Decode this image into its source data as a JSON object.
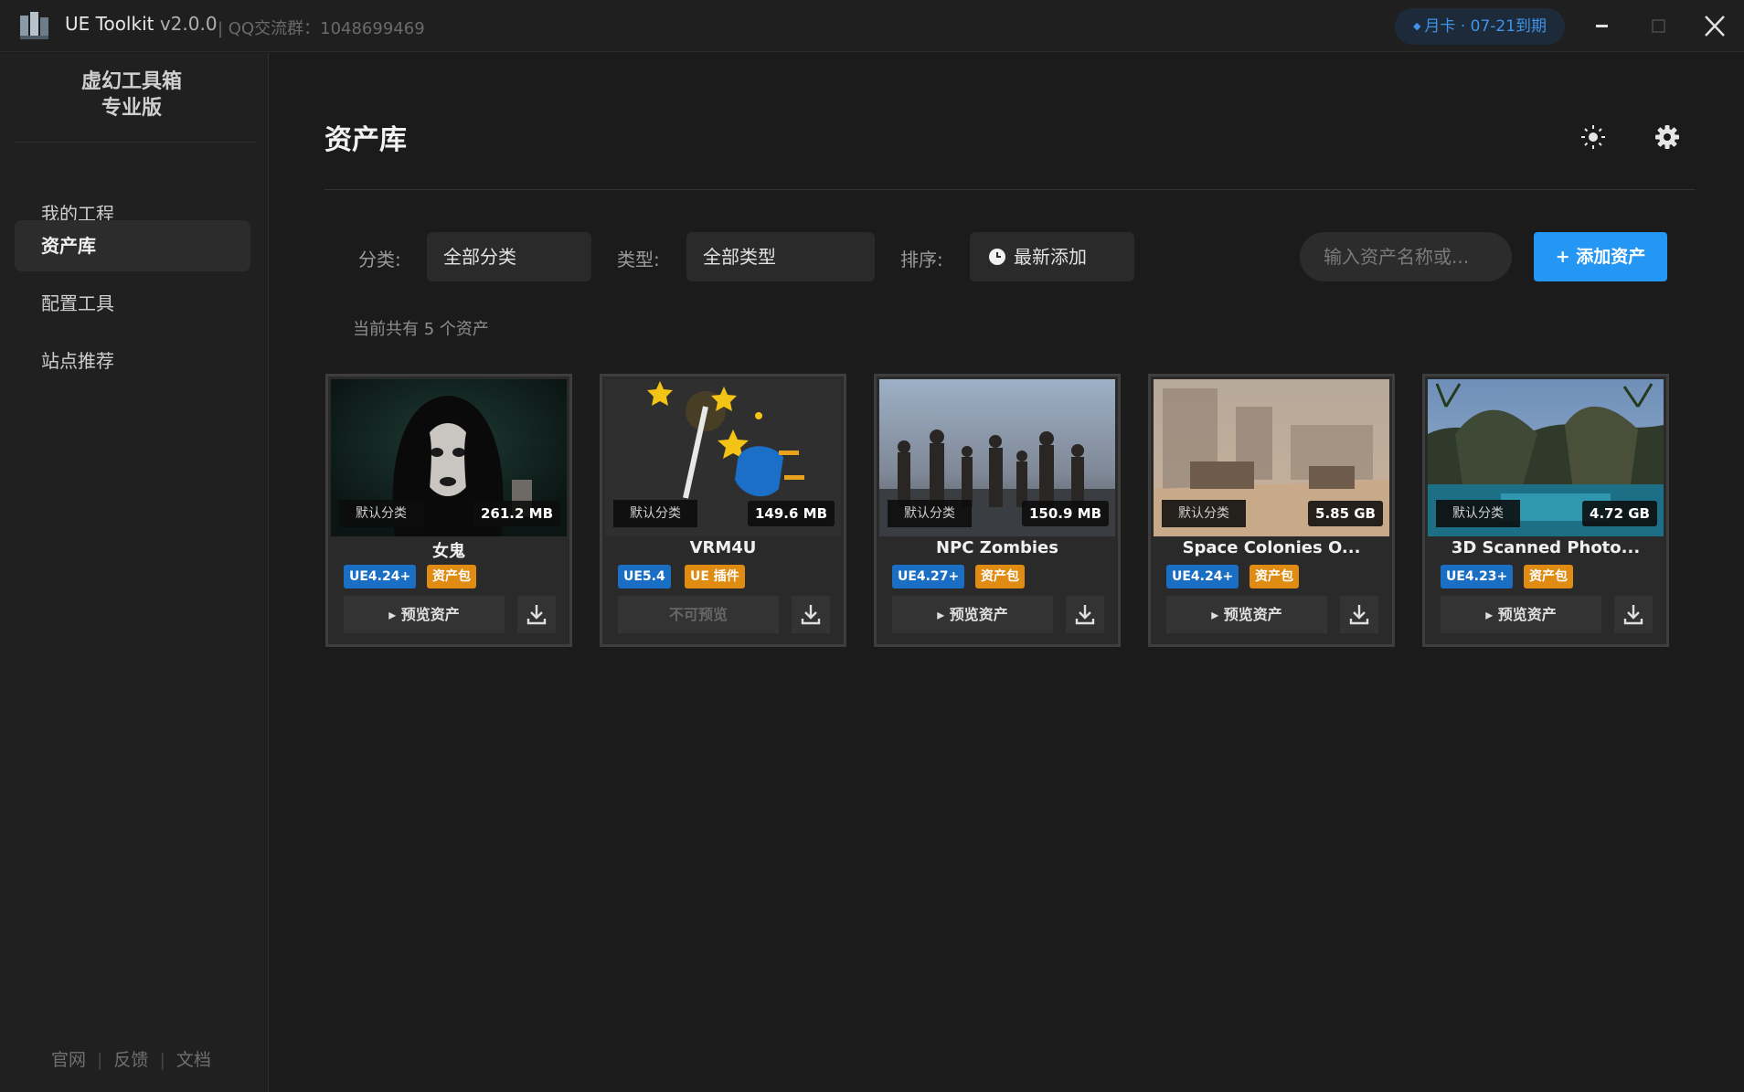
{
  "titlebar": {
    "app_name": "UE Toolkit",
    "version": "v2.0.0",
    "qq_info": "| QQ交流群：1048699469",
    "subscription_badge": "月卡 · 07-21到期",
    "window_controls": [
      "minimize-icon",
      "maximize-icon",
      "close-icon"
    ]
  },
  "sidebar": {
    "brand_line1": "虚幻工具箱",
    "brand_line2": "专业版",
    "items": [
      {
        "label": "我的工程",
        "active": false
      },
      {
        "label": "资产库",
        "active": true
      },
      {
        "label": "配置工具",
        "active": false
      },
      {
        "label": "站点推荐",
        "active": false
      }
    ],
    "footer": [
      "官网",
      "反馈",
      "文档"
    ]
  },
  "main": {
    "title": "资产库",
    "header_icons": [
      "sun-icon",
      "gear-icon"
    ],
    "filters": {
      "category_label": "分类:",
      "category_value": "全部分类",
      "type_label": "类型:",
      "type_value": "全部类型",
      "sort_label": "排序:",
      "sort_value": "最新添加",
      "search_placeholder": "输入资产名称或...",
      "add_button": "+ 添加资产"
    },
    "count_text": "当前共有 5 个资产",
    "assets": [
      {
        "name": "女鬼",
        "category": "默认分类",
        "size": "261.2 MB",
        "version": "UE4.24+",
        "type": "资产包",
        "preview": "▸ 预览资产",
        "preview_enabled": true
      },
      {
        "name": "VRM4U",
        "category": "默认分类",
        "size": "149.6 MB",
        "version": "UE5.4",
        "type": "UE 插件",
        "preview": "不可预览",
        "preview_enabled": false
      },
      {
        "name": "NPC Zombies",
        "category": "默认分类",
        "size": "150.9 MB",
        "version": "UE4.27+",
        "type": "资产包",
        "preview": "▸ 预览资产",
        "preview_enabled": true
      },
      {
        "name": "Space Colonies O...",
        "category": "默认分类",
        "size": "5.85 GB",
        "version": "UE4.24+",
        "type": "资产包",
        "preview": "▸ 预览资产",
        "preview_enabled": true
      },
      {
        "name": "3D Scanned Photo...",
        "category": "默认分类",
        "size": "4.72 GB",
        "version": "UE4.23+",
        "type": "资产包",
        "preview": "▸ 预览资产",
        "preview_enabled": true
      }
    ]
  },
  "colors": {
    "accent": "#2496f3",
    "ue_badge": "#1a6fc4",
    "pack_badge": "#e08b12",
    "background": "#1b1b1b",
    "sidebar": "#202020"
  }
}
